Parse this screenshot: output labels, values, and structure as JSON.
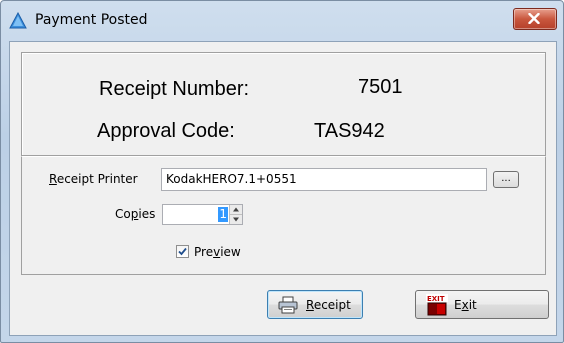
{
  "window": {
    "title": "Payment Posted",
    "app_icon": "triangle-app-icon",
    "close_icon": "close-x-icon"
  },
  "receipt": {
    "number_label": "Receipt Number:",
    "number_value": "7501",
    "approval_label": "Approval Code:",
    "approval_value": "TAS942"
  },
  "form": {
    "printer_label_key": "R",
    "printer_label_rest": "eceipt Printer",
    "printer_value": "KodakHERO7.1+0551",
    "browse_label": "...",
    "copies_label_pre": "Co",
    "copies_label_key": "p",
    "copies_label_post": "ies",
    "copies_value": "1",
    "preview_label_pre": "Pre",
    "preview_label_key": "v",
    "preview_label_post": "iew",
    "preview_checked": true
  },
  "buttons": {
    "receipt_key": "R",
    "receipt_rest": "eceipt",
    "receipt_icon": "printer-icon",
    "exit_pre": "E",
    "exit_key": "x",
    "exit_post": "it",
    "exit_icon": "exit-sign-icon",
    "exit_icon_text": "EXIT"
  },
  "colors": {
    "title_bar": "#c4d6ea",
    "close_button": "#c9573e",
    "selection": "#3399ff"
  }
}
